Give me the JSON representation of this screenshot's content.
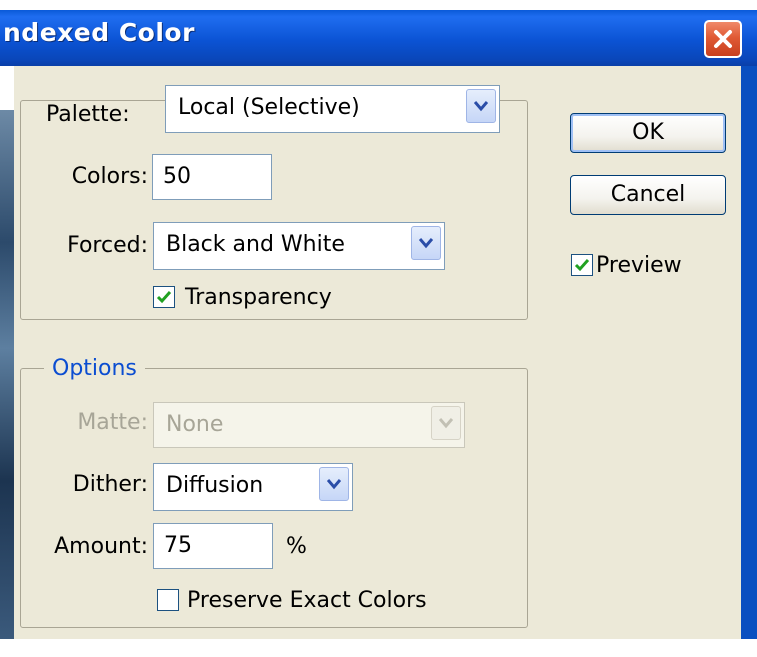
{
  "window": {
    "title": "ndexed Color",
    "close_icon": "close-x-icon"
  },
  "palette_group": {
    "palette_label": "Palette:",
    "palette_value": "Local (Selective)",
    "colors_label": "Colors:",
    "colors_value": "50",
    "forced_label": "Forced:",
    "forced_value": "Black and White",
    "transparency_label": "Transparency",
    "transparency_checked": true
  },
  "options_group": {
    "legend": "Options",
    "matte_label": "Matte:",
    "matte_value": "None",
    "matte_disabled": true,
    "dither_label": "Dither:",
    "dither_value": "Diffusion",
    "amount_label": "Amount:",
    "amount_value": "75",
    "amount_unit": "%",
    "preserve_label": "Preserve Exact Colors",
    "preserve_checked": false
  },
  "buttons": {
    "ok_label": "OK",
    "cancel_label": "Cancel"
  },
  "preview": {
    "label": "Preview",
    "checked": true
  },
  "colors": {
    "titlebar": "#0b53d4",
    "dialog_bg": "#ece9d8",
    "options_legend": "#0b4dd1",
    "disabled_text": "#a7a597",
    "checkmark": "#21a121"
  }
}
